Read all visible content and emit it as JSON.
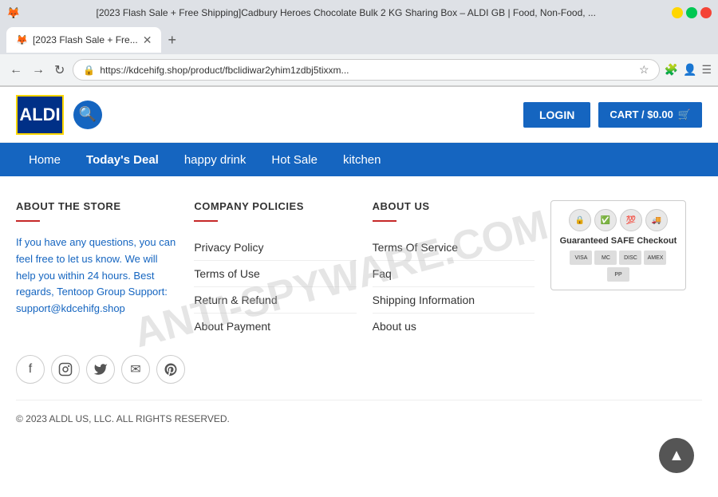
{
  "browser": {
    "title": "[2023 Flash Sale + Free Shipping]Cadbury Heroes Chocolate Bulk 2 KG Sharing Box – ALDI GB | Food, Non-Food, ...",
    "tab_label": "[2023 Flash Sale + Fre...",
    "url": "https://kdcehifg.shop/product/fbclidiwar2yhim1zdbj5tixxm...",
    "new_tab_label": "+"
  },
  "header": {
    "logo_text": "ALDI",
    "search_icon": "🔍",
    "login_label": "LOGIN",
    "cart_label": "CART / $0.00",
    "cart_icon": "🛒"
  },
  "nav": {
    "items": [
      {
        "label": "Home",
        "active": false
      },
      {
        "label": "Today's Deal",
        "active": true
      },
      {
        "label": "happy drink",
        "active": false
      },
      {
        "label": "Hot Sale",
        "active": false
      },
      {
        "label": "kitchen",
        "active": false
      }
    ]
  },
  "footer": {
    "about_store": {
      "title": "ABOUT THE STORE",
      "text": "If you have any questions, you can feel free to let us know. We will help you within 24 hours. Best regards, Tentoop Group Support: support@kdcehifg.shop"
    },
    "company_policies": {
      "title": "COMPANY POLICIES",
      "links": [
        "Privacy Policy",
        "Terms of Use",
        "Return & Refund",
        "About Payment"
      ]
    },
    "about_us": {
      "title": "ABOUT US",
      "links": [
        "Terms Of Service",
        "Faq",
        "Shipping Information",
        "About us"
      ]
    },
    "safe_checkout": {
      "title": "Guaranteed SAFE Checkout",
      "badge_icons": [
        "🔒",
        "✅",
        "💯",
        "🚚"
      ],
      "payment_methods": [
        "VISA",
        "MC",
        "DISC",
        "AMEX",
        "PP"
      ]
    },
    "social": {
      "icons": [
        "f",
        "📷",
        "🐦",
        "✉",
        "📌"
      ]
    },
    "copyright": "© 2023 ALDL US, LLC. ALL RIGHTS RESERVED."
  },
  "watermark": "ANTI-SPYWARE.COM",
  "back_to_top": "▲"
}
